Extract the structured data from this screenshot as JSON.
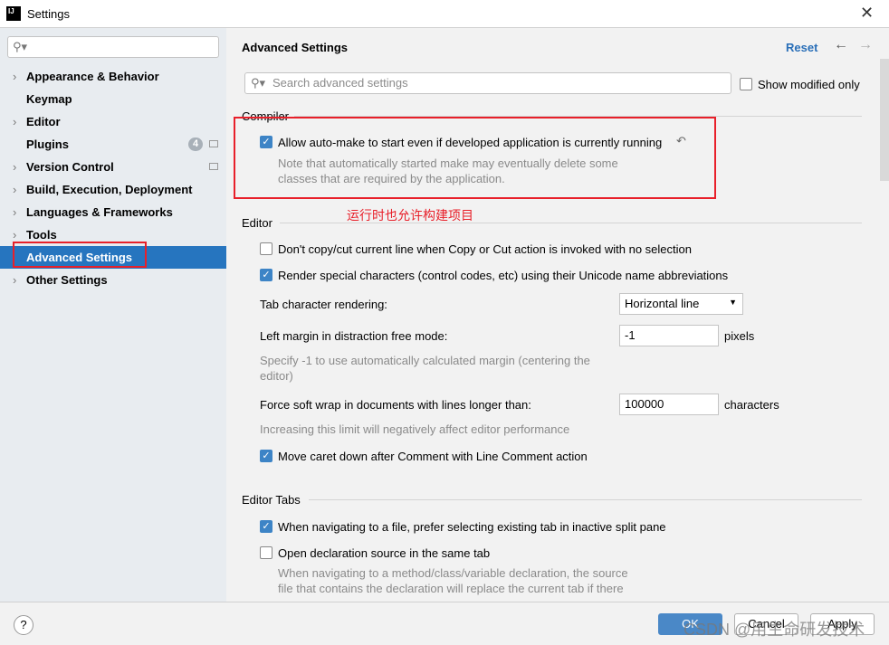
{
  "window": {
    "title": "Settings",
    "logo": "IJ"
  },
  "sidebar": {
    "items": [
      {
        "label": "Appearance & Behavior",
        "expandable": true
      },
      {
        "label": "Keymap",
        "expandable": false
      },
      {
        "label": "Editor",
        "expandable": true
      },
      {
        "label": "Plugins",
        "expandable": false,
        "badge": "4"
      },
      {
        "label": "Version Control",
        "expandable": true
      },
      {
        "label": "Build, Execution, Deployment",
        "expandable": true
      },
      {
        "label": "Languages & Frameworks",
        "expandable": true
      },
      {
        "label": "Tools",
        "expandable": true
      },
      {
        "label": "Advanced Settings",
        "expandable": false,
        "selected": true
      },
      {
        "label": "Other Settings",
        "expandable": true
      }
    ]
  },
  "main": {
    "title": "Advanced Settings",
    "reset": "Reset",
    "search_placeholder": "Search advanced settings",
    "show_modified": "Show modified only",
    "compiler": {
      "header": "Compiler",
      "option": "Allow auto-make to start even if developed application is currently running",
      "note1": "Note that automatically started make may eventually delete some",
      "note2": "classes that are required by the application.",
      "annotation": "运行时也允许构建项目"
    },
    "editor": {
      "header": "Editor",
      "opt1": "Don't copy/cut current line when Copy or Cut action is invoked with no selection",
      "opt2": "Render special characters (control codes, etc) using their Unicode name abbreviations",
      "tab_label": "Tab character rendering:",
      "tab_value": "Horizontal line",
      "margin_label": "Left margin in distraction free mode:",
      "margin_value": "-1",
      "margin_unit": "pixels",
      "margin_note1": "Specify -1 to use automatically calculated margin (centering the",
      "margin_note2": "editor)",
      "wrap_label": "Force soft wrap in documents with lines longer than:",
      "wrap_value": "100000",
      "wrap_unit": "characters",
      "wrap_note": "Increasing this limit will negatively affect editor performance",
      "opt3": "Move caret down after Comment with Line Comment action"
    },
    "tabs": {
      "header": "Editor Tabs",
      "opt1": "When navigating to a file, prefer selecting existing tab in inactive split pane",
      "opt2": "Open declaration source in the same tab",
      "note1": "When navigating to a method/class/variable declaration, the source",
      "note2": "file that contains the declaration will replace the current tab if there"
    }
  },
  "footer": {
    "help": "?",
    "ok": "OK",
    "cancel": "Cancel",
    "apply": "Apply",
    "watermark": "CSDN @用生命研发技术"
  }
}
